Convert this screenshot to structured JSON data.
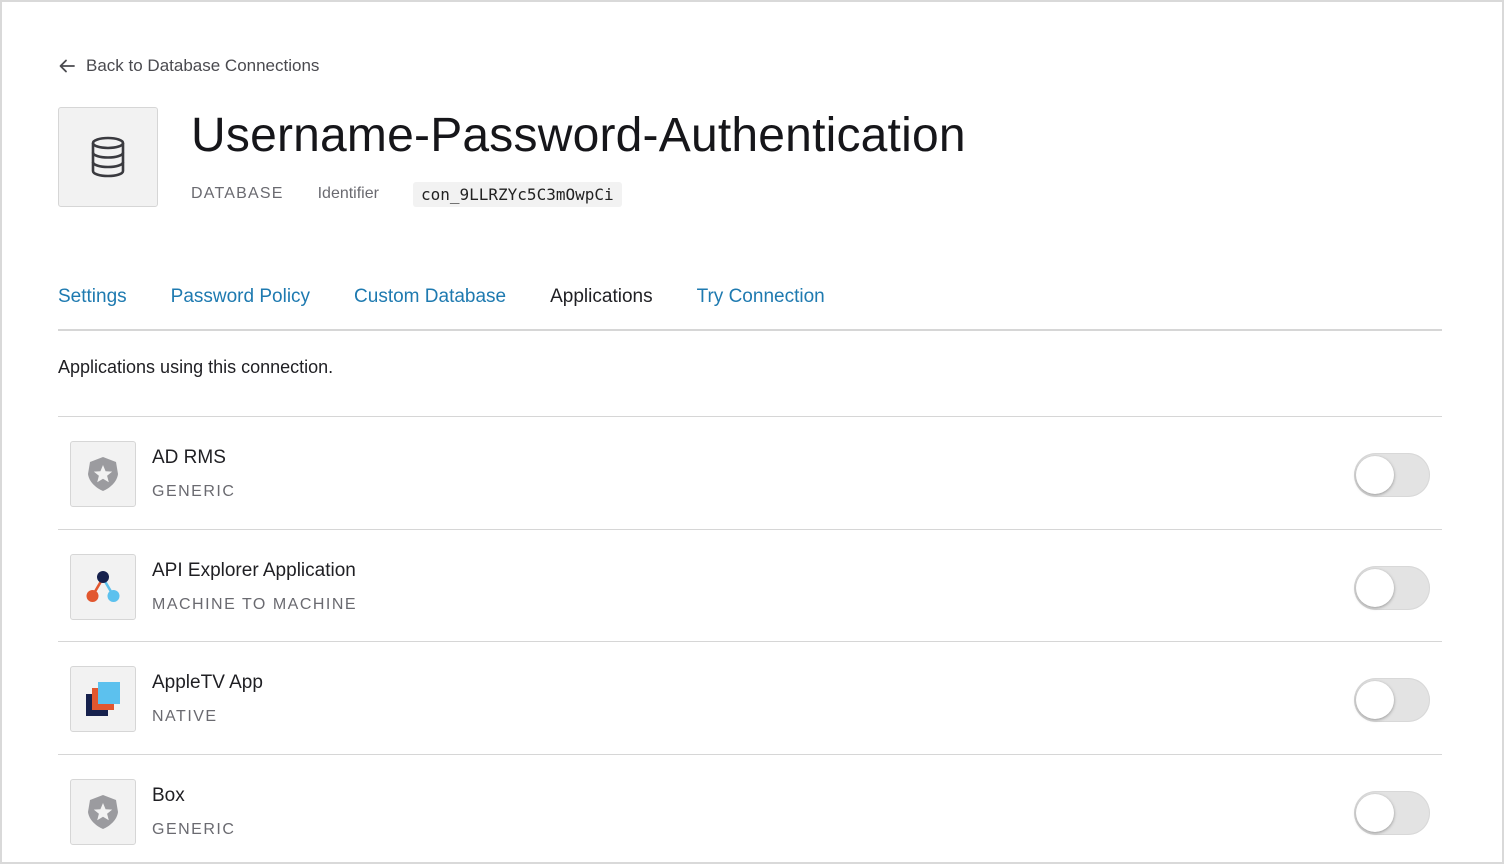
{
  "nav": {
    "back_label": "Back to Database Connections",
    "back_icon": "arrow-left-icon"
  },
  "connection": {
    "icon": "database-icon",
    "name": "Username-Password-Authentication",
    "type": "DATABASE",
    "identifier_label": "Identifier",
    "identifier": "con_9LLRZYc5C3mOwpCi"
  },
  "tabs": [
    {
      "label": "Settings",
      "active": false
    },
    {
      "label": "Password Policy",
      "active": false
    },
    {
      "label": "Custom Database",
      "active": false
    },
    {
      "label": "Applications",
      "active": true
    },
    {
      "label": "Try Connection",
      "active": false
    }
  ],
  "intro_text": "Applications using this connection.",
  "applications": [
    {
      "name": "AD RMS",
      "type": "GENERIC",
      "icon": "shield-star-icon",
      "enabled": false
    },
    {
      "name": "API Explorer Application",
      "type": "MACHINE TO MACHINE",
      "icon": "network-nodes-icon",
      "enabled": false
    },
    {
      "name": "AppleTV App",
      "type": "NATIVE",
      "icon": "stacked-squares-icon",
      "enabled": false
    },
    {
      "name": "Box",
      "type": "GENERIC",
      "icon": "shield-star-icon",
      "enabled": false
    }
  ],
  "colors": {
    "link": "#1e7ab0",
    "text": "#1f1f23",
    "muted": "#6a6a70",
    "toggle_off": "#e3e3e3",
    "m2m_dark": "#16214d",
    "m2m_orange": "#e2572f",
    "m2m_blue": "#5cc1ee",
    "native_dark": "#16214d",
    "native_orange": "#e2572f",
    "native_blue": "#5cc1ee"
  }
}
